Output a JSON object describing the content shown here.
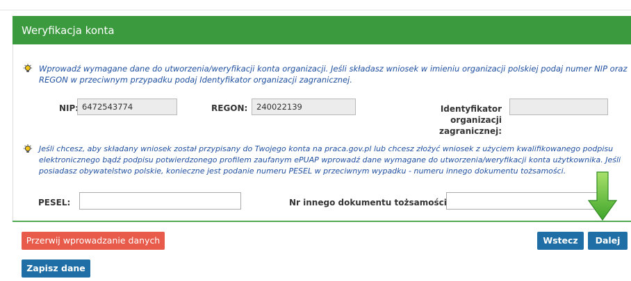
{
  "header": {
    "title": "Weryfikacja konta"
  },
  "info_icon": "lightbulb-icon",
  "info1": {
    "line1": "Wprowadź wymagane dane do utworzenia/weryfikacji konta organizacji. Jeśli składasz wniosek w imieniu organizacji polskiej podaj numer NIP oraz",
    "line2": "REGON w przeciwnym przypadku podaj Identyfikator organizacji zagranicznej."
  },
  "org": {
    "nip_label": "NIP:",
    "nip_value": "6472543774",
    "regon_label": "REGON:",
    "regon_value": "240022139",
    "foreign_label_1": "Identyfikator organizacji",
    "foreign_label_2": "zagranicznej:",
    "foreign_value": ""
  },
  "info2": {
    "line1": "Jeśli chcesz, aby składany wniosek został przypisany do Twojego konta na praca.gov.pl lub chcesz złożyć wniosek z użyciem kwalifikowanego podpisu",
    "line2": "elektronicznego bądź podpisu potwierdzonego profilem zaufanym ePUAP wprowadź dane wymagane do utworzenia/weryfikacji konta użytkownika. Jeśli",
    "line3": "posiadasz obywatelstwo polskie, konieczne jest podanie numeru PESEL w przeciwnym wypadku - numeru innego dokumentu tożsamości."
  },
  "person": {
    "pesel_label": "PESEL:",
    "pesel_value": "",
    "doc_label": "Nr innego dokumentu tożsamości:",
    "doc_value": ""
  },
  "buttons": {
    "cancel": "Przerwij wprowadzanie danych",
    "back": "Wstecz",
    "next": "Dalej",
    "save": "Zapisz dane"
  },
  "colors": {
    "header": "#3a9a3d",
    "primary_button": "#1f6fa6",
    "danger_button": "#e85a4a",
    "info_text": "#1f4fa0",
    "arrow": "#6cc93a"
  }
}
